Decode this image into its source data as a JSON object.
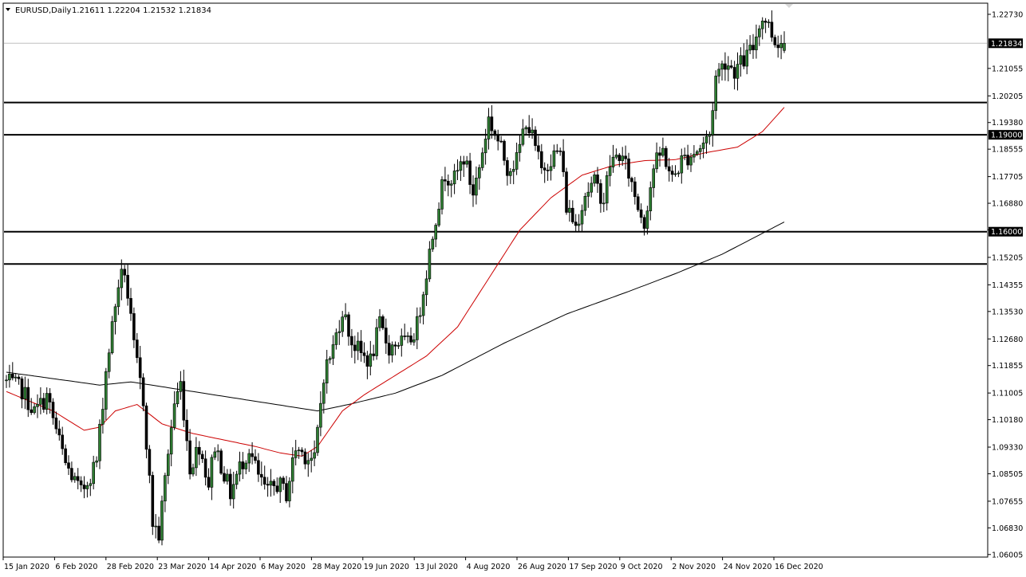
{
  "header": {
    "symbol": "EURUSD,Daily",
    "ohlc": "1.21611 1.22204 1.21532 1.21834",
    "menu_icon": "triangle-down-icon"
  },
  "chart_data": {
    "type": "candlestick",
    "symbol": "EURUSD",
    "timeframe": "Daily",
    "last_bar": {
      "open": 1.21611,
      "high": 1.22204,
      "low": 1.21532,
      "close": 1.21834
    },
    "current_price": 1.21834,
    "ylim": [
      1.0595,
      1.2305
    ],
    "y_ticks": [
      "1.22730",
      "1.21055",
      "1.20205",
      "1.19380",
      "1.18555",
      "1.17705",
      "1.16880",
      "1.16055",
      "1.15205",
      "1.14355",
      "1.13530",
      "1.12680",
      "1.11855",
      "1.11005",
      "1.10180",
      "1.09330",
      "1.08505",
      "1.07655",
      "1.06830",
      "1.06005"
    ],
    "x_ticks": [
      "15 Jan 2020",
      "6 Feb 2020",
      "28 Feb 2020",
      "23 Mar 2020",
      "14 Apr 2020",
      "6 May 2020",
      "28 May 2020",
      "19 Jun 2020",
      "13 Jul 2020",
      "4 Aug 2020",
      "26 Aug 2020",
      "17 Sep 2020",
      "9 Oct 2020",
      "2 Nov 2020",
      "24 Nov 2020",
      "16 Dec 2020"
    ],
    "horizontal_levels": [
      {
        "price": 1.2,
        "label": ""
      },
      {
        "price": 1.19,
        "label": "1.19000"
      },
      {
        "price": 1.16,
        "label": "1.16000"
      },
      {
        "price": 1.15,
        "label": ""
      }
    ],
    "colors": {
      "bull_body": "#2e7d32",
      "bear_body": "#000000",
      "wick": "#000000",
      "ma_fast": "#cc0000",
      "ma_slow": "#000000",
      "level": "#000000",
      "price_line": "#c0c0c0",
      "badge_bg": "#000000"
    },
    "ma_fast": {
      "name": "",
      "anchors": [
        [
          0,
          1.1105
        ],
        [
          15,
          1.1045
        ],
        [
          25,
          1.0985
        ],
        [
          30,
          1.0995
        ],
        [
          35,
          1.1045
        ],
        [
          42,
          1.1065
        ],
        [
          50,
          1.1005
        ],
        [
          60,
          1.0975
        ],
        [
          70,
          1.0955
        ],
        [
          80,
          1.0935
        ],
        [
          88,
          1.0915
        ],
        [
          95,
          1.0905
        ],
        [
          100,
          1.0935
        ],
        [
          108,
          1.1045
        ],
        [
          115,
          1.1095
        ],
        [
          125,
          1.1155
        ],
        [
          135,
          1.1215
        ],
        [
          145,
          1.1305
        ],
        [
          155,
          1.1455
        ],
        [
          165,
          1.1605
        ],
        [
          175,
          1.1705
        ],
        [
          185,
          1.1775
        ],
        [
          195,
          1.1805
        ],
        [
          205,
          1.182
        ],
        [
          215,
          1.1823
        ],
        [
          225,
          1.1845
        ],
        [
          235,
          1.1862
        ],
        [
          243,
          1.191
        ],
        [
          250,
          1.1985
        ]
      ]
    },
    "ma_slow": {
      "name": "",
      "anchors": [
        [
          0,
          1.1165
        ],
        [
          15,
          1.1145
        ],
        [
          30,
          1.1125
        ],
        [
          40,
          1.1135
        ],
        [
          60,
          1.1105
        ],
        [
          80,
          1.1075
        ],
        [
          100,
          1.1045
        ],
        [
          110,
          1.1065
        ],
        [
          125,
          1.11
        ],
        [
          140,
          1.1155
        ],
        [
          160,
          1.1255
        ],
        [
          180,
          1.1345
        ],
        [
          200,
          1.1415
        ],
        [
          215,
          1.147
        ],
        [
          230,
          1.153
        ],
        [
          240,
          1.158
        ],
        [
          250,
          1.163
        ]
      ]
    },
    "price_anchors": [
      [
        0,
        1.114
      ],
      [
        6,
        1.111
      ],
      [
        10,
        1.104
      ],
      [
        14,
        1.109
      ],
      [
        20,
        1.088
      ],
      [
        25,
        1.079
      ],
      [
        30,
        1.089
      ],
      [
        33,
        1.117
      ],
      [
        37,
        1.144
      ],
      [
        39,
        1.148
      ],
      [
        42,
        1.124
      ],
      [
        45,
        1.108
      ],
      [
        48,
        1.07
      ],
      [
        50,
        1.066
      ],
      [
        53,
        1.092
      ],
      [
        55,
        1.107
      ],
      [
        57,
        1.113
      ],
      [
        60,
        1.087
      ],
      [
        63,
        1.094
      ],
      [
        66,
        1.082
      ],
      [
        68,
        1.094
      ],
      [
        70,
        1.088
      ],
      [
        73,
        1.079
      ],
      [
        76,
        1.087
      ],
      [
        79,
        1.093
      ],
      [
        82,
        1.084
      ],
      [
        85,
        1.079
      ],
      [
        88,
        1.082
      ],
      [
        91,
        1.079
      ],
      [
        94,
        1.093
      ],
      [
        97,
        1.091
      ],
      [
        100,
        1.089
      ],
      [
        103,
        1.116
      ],
      [
        106,
        1.124
      ],
      [
        109,
        1.136
      ],
      [
        112,
        1.126
      ],
      [
        115,
        1.122
      ],
      [
        118,
        1.12
      ],
      [
        121,
        1.131
      ],
      [
        124,
        1.124
      ],
      [
        127,
        1.126
      ],
      [
        130,
        1.125
      ],
      [
        133,
        1.131
      ],
      [
        136,
        1.148
      ],
      [
        139,
        1.165
      ],
      [
        142,
        1.178
      ],
      [
        145,
        1.176
      ],
      [
        148,
        1.183
      ],
      [
        151,
        1.172
      ],
      [
        153,
        1.18
      ],
      [
        156,
        1.195
      ],
      [
        159,
        1.188
      ],
      [
        162,
        1.18
      ],
      [
        165,
        1.182
      ],
      [
        168,
        1.195
      ],
      [
        170,
        1.189
      ],
      [
        173,
        1.179
      ],
      [
        176,
        1.183
      ],
      [
        179,
        1.185
      ],
      [
        181,
        1.168
      ],
      [
        184,
        1.162
      ],
      [
        187,
        1.172
      ],
      [
        190,
        1.175
      ],
      [
        193,
        1.17
      ],
      [
        195,
        1.181
      ],
      [
        198,
        1.184
      ],
      [
        201,
        1.178
      ],
      [
        204,
        1.168
      ],
      [
        206,
        1.163
      ],
      [
        209,
        1.18
      ],
      [
        212,
        1.185
      ],
      [
        215,
        1.176
      ],
      [
        218,
        1.182
      ],
      [
        221,
        1.184
      ],
      [
        224,
        1.186
      ],
      [
        227,
        1.19
      ],
      [
        229,
        1.208
      ],
      [
        232,
        1.213
      ],
      [
        235,
        1.21
      ],
      [
        238,
        1.213
      ],
      [
        241,
        1.217
      ],
      [
        243,
        1.225
      ],
      [
        245,
        1.226
      ],
      [
        248,
        1.219
      ]
    ]
  }
}
